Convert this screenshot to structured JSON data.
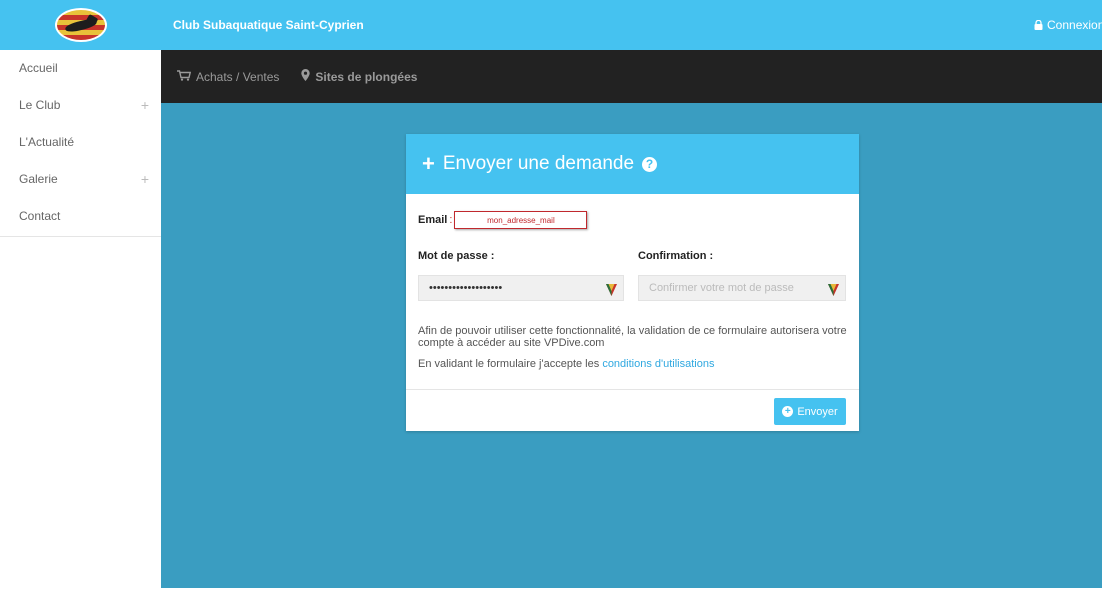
{
  "header": {
    "club_name": "Club Subaquatique Saint-Cyprien",
    "login_label": "Connexion",
    "color": "#45c2f0"
  },
  "subnav": {
    "items": [
      {
        "label": "Achats / Ventes",
        "icon": "cart-icon"
      },
      {
        "label": "Sites de plongées",
        "icon": "map-marker-icon"
      }
    ]
  },
  "sidebar": {
    "items": [
      {
        "label": "Accueil",
        "expand": ""
      },
      {
        "label": "Le Club",
        "expand": "+"
      },
      {
        "label": "L'Actualité",
        "expand": ""
      },
      {
        "label": "Galerie",
        "expand": "+"
      },
      {
        "label": "Contact",
        "expand": ""
      }
    ]
  },
  "form": {
    "title": "Envoyer une demande",
    "email_label": "Email",
    "email_sep": ":",
    "email_value": "mon_adresse_mail",
    "password_label": "Mot de passe :",
    "password_value": "•••••••••••••••••••",
    "confirm_label": "Confirmation :",
    "confirm_placeholder": "Confirmer votre mot de passe",
    "info": "Afin de pouvoir utiliser cette fonctionnalité, la validation de ce formulaire autorisera votre compte à accéder au site VPDive.com",
    "terms_prefix": "En validant le formulaire j'accepte les ",
    "terms_link": "conditions d'utilisations",
    "submit_label": "Envoyer"
  },
  "colors": {
    "main_bg": "#3a9dc1",
    "subnav_bg": "#222222",
    "accent": "#45c2f0",
    "error": "#c0282d"
  }
}
